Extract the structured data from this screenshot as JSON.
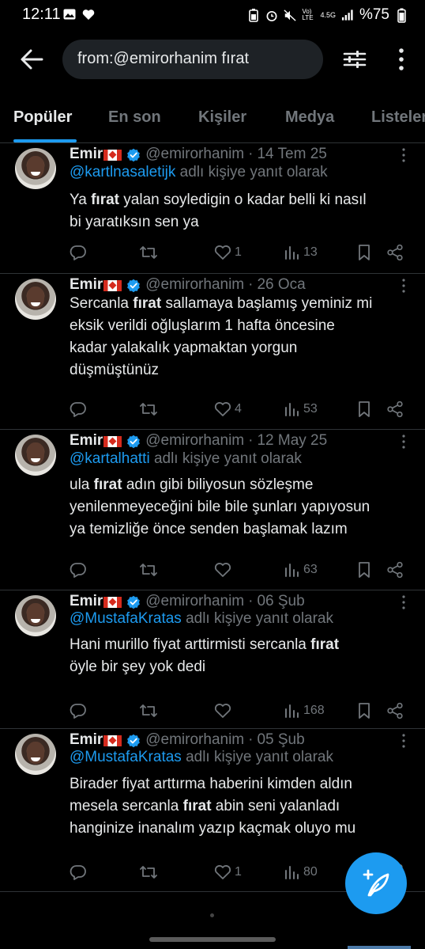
{
  "status_bar": {
    "time": "12:11",
    "network": "4.5G",
    "lte": "Vo) LTE",
    "battery": "%75"
  },
  "search": {
    "query": "from:@emirorhanim fırat"
  },
  "tabs": [
    {
      "label": "Popüler",
      "active": true
    },
    {
      "label": "En son"
    },
    {
      "label": "Kişiler"
    },
    {
      "label": "Medya"
    },
    {
      "label": "Listeler"
    }
  ],
  "tweets": [
    {
      "name": "Emir",
      "handle": "@emirorhanim",
      "dot": "·",
      "date": "14 Tem 25",
      "reply_mention": "@kartlnasaletijk",
      "reply_suffix": " adlı kişiye yanıt olarak",
      "lines": [
        [
          "Ya ",
          "fırat",
          " yalan soyledigin o kadar belli ki nasıl"
        ],
        [
          "bi yaratıksın sen ya",
          "",
          ""
        ]
      ],
      "likes": "1",
      "views": "13"
    },
    {
      "name": "Emir",
      "handle": "@emirorhanim",
      "dot": "·",
      "date": "26 Oca",
      "reply_mention": "",
      "reply_suffix": "",
      "lines": [
        [
          "Sercanla ",
          "fırat",
          " sallamaya başlamış yeminiz mi"
        ],
        [
          "eksik verildi oğluşlarım 1 hafta öncesine",
          "",
          ""
        ],
        [
          "kadar yalakalık yapmaktan yorgun",
          "",
          ""
        ],
        [
          "düşmüştünüz",
          "",
          ""
        ]
      ],
      "likes": "4",
      "views": "53"
    },
    {
      "name": "Emir",
      "handle": "@emirorhanim",
      "dot": "·",
      "date": "12 May 25",
      "reply_mention": "@kartalhatti",
      "reply_suffix": " adlı kişiye yanıt olarak",
      "lines": [
        [
          "ula ",
          "fırat",
          " adın gibi biliyosun sözleşme"
        ],
        [
          "yenilenmeyeceğini bile bile şunları yapıyosun",
          "",
          ""
        ],
        [
          "ya temizliğe önce senden başlamak lazım",
          "",
          ""
        ]
      ],
      "likes": "",
      "views": "63"
    },
    {
      "name": "Emir",
      "handle": "@emirorhanim",
      "dot": "·",
      "date": "06 Şub",
      "reply_mention": "@MustafaKratas",
      "reply_suffix": " adlı kişiye yanıt olarak",
      "lines": [
        [
          "Hani murillo fiyat arttirmisti sercanla ",
          "fırat",
          ""
        ],
        [
          "öyle bir şey yok dedi",
          "",
          ""
        ]
      ],
      "likes": "",
      "views": "168"
    },
    {
      "name": "Emir",
      "handle": "@emirorhanim",
      "dot": "·",
      "date": "05 Şub",
      "reply_mention": "@MustafaKratas",
      "reply_suffix": " adlı kişiye yanıt olarak",
      "lines": [
        [
          "Birader fiyat arttırma haberini kimden aldın",
          "",
          ""
        ],
        [
          "mesela sercanla ",
          "fırat",
          " abin seni yalanladı"
        ],
        [
          "hanginize inanalım yazıp kaçmak oluyo mu",
          "",
          ""
        ]
      ],
      "likes": "1",
      "views": "80"
    }
  ],
  "colors": {
    "accent": "#1d9bf0",
    "background": "#000000",
    "secondary_text": "#71767b"
  }
}
